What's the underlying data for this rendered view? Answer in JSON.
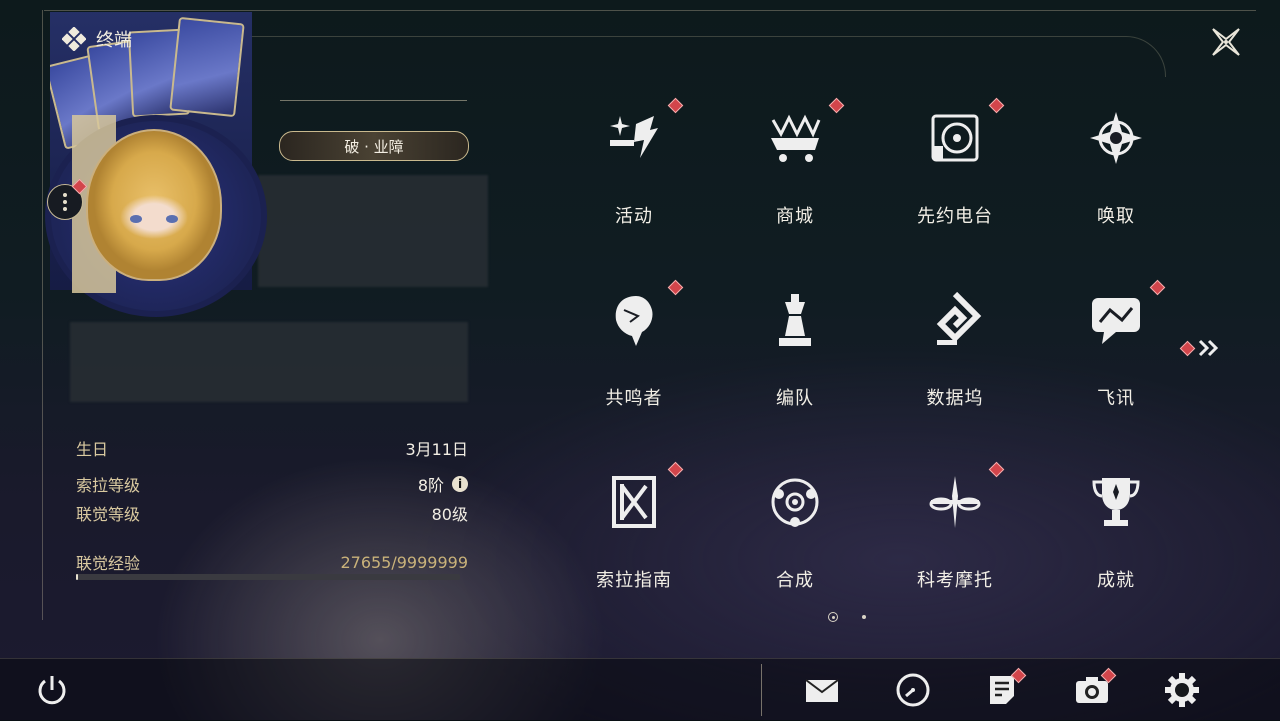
{
  "header": {
    "title": "终端"
  },
  "profile": {
    "title_badge": "破 · 业障",
    "stats": [
      {
        "label": "生日",
        "value": "3月11日"
      },
      {
        "label": "索拉等级",
        "value": "8阶"
      },
      {
        "label": "联觉等级",
        "value": "80级"
      }
    ],
    "exp": {
      "label": "联觉经验",
      "value": "27655/9999999",
      "progress": 0.003
    }
  },
  "menu": {
    "items": [
      {
        "label": "活动",
        "icon": "sparkle-icon",
        "badge": true
      },
      {
        "label": "商城",
        "icon": "crown-cart-icon",
        "badge": true
      },
      {
        "label": "先约电台",
        "icon": "turntable-icon",
        "badge": true
      },
      {
        "label": "唤取",
        "icon": "compass-star-icon",
        "badge": false
      },
      {
        "label": "共鸣者",
        "icon": "character-profile-icon",
        "badge": true
      },
      {
        "label": "编队",
        "icon": "chess-piece-icon",
        "badge": false
      },
      {
        "label": "数据坞",
        "icon": "data-dock-icon",
        "badge": false
      },
      {
        "label": "飞讯",
        "icon": "chat-icon",
        "badge": true
      },
      {
        "label": "索拉指南",
        "icon": "guide-book-icon",
        "badge": true
      },
      {
        "label": "合成",
        "icon": "synthesis-icon",
        "badge": false
      },
      {
        "label": "科考摩托",
        "icon": "motorbike-icon",
        "badge": true
      },
      {
        "label": "成就",
        "icon": "trophy-icon",
        "badge": false
      }
    ],
    "pages": 2,
    "current_page": 1
  },
  "bottom": {
    "icons": [
      "power-icon",
      "mail-icon",
      "clock-icon",
      "notice-icon",
      "camera-icon",
      "settings-icon"
    ]
  },
  "colors": {
    "accent": "#c9b98e",
    "badge": "#d2454b",
    "text": "#f2efe6",
    "label": "#d9c9a0"
  }
}
